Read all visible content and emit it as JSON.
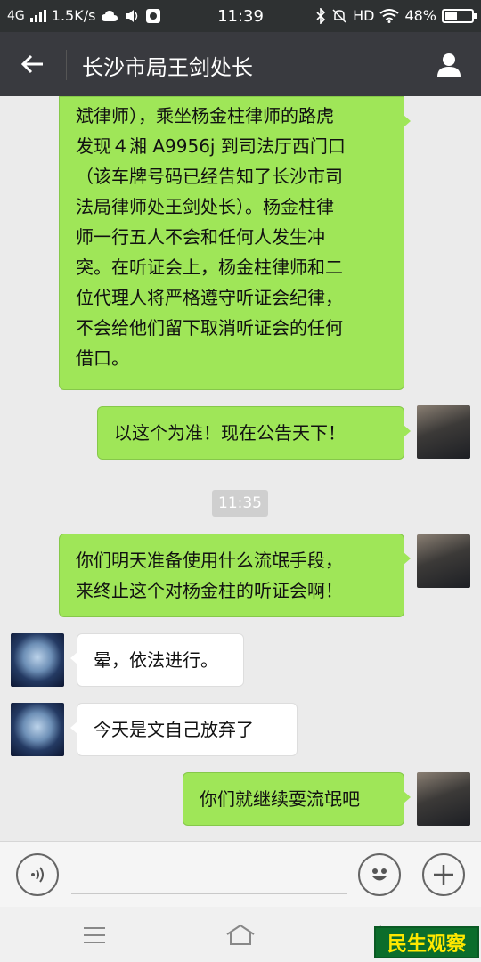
{
  "status_bar": {
    "network": "4G",
    "speed": "1.5K/s",
    "time": "11:39",
    "hd": "HD",
    "battery": "48%",
    "battery_level": 0.48
  },
  "header": {
    "title": "长沙市局王剑处长",
    "back_icon": "arrow-left-icon",
    "profile_icon": "person-icon"
  },
  "messages": [
    {
      "side": "right",
      "lines": [
        "斌律师），乘坐杨金柱律师的路虎",
        "发现４湘 A9956j 到司法厅西门口",
        "（该车牌号码已经告知了长沙市司",
        "法局律师处王剑处长）。杨金柱律",
        "师一行五人不会和任何人发生冲",
        "突。在听证会上，杨金柱律师和二",
        "位代理人将严格遵守听证会纪律，",
        "不会给他们留下取消听证会的任何",
        "借口。"
      ]
    },
    {
      "side": "right",
      "text": "以这个为准！现在公告天下！"
    },
    {
      "timestamp": "11:35"
    },
    {
      "side": "right",
      "lines": [
        "你们明天准备使用什么流氓手段，",
        "来终止这个对杨金柱的听证会啊！"
      ]
    },
    {
      "side": "left",
      "text": "晕，依法进行。"
    },
    {
      "side": "left",
      "text": "今天是文自己放弃了"
    },
    {
      "side": "right",
      "text": "你们就继续耍流氓吧"
    }
  ],
  "input_bar": {
    "voice_icon": "voice-icon",
    "emoji_icon": "emoji-icon",
    "plus_icon": "plus-icon"
  },
  "nav_bar": {
    "menu_icon": "menu-icon",
    "home_icon": "home-icon",
    "back_icon": "back-icon"
  },
  "watermark": "民生观察",
  "colors": {
    "bubble_green": "#9fe658",
    "header_bg": "#393a3f",
    "chat_bg": "#ebebeb",
    "watermark_bg": "#0b6d2b",
    "watermark_text": "#ffe800"
  }
}
